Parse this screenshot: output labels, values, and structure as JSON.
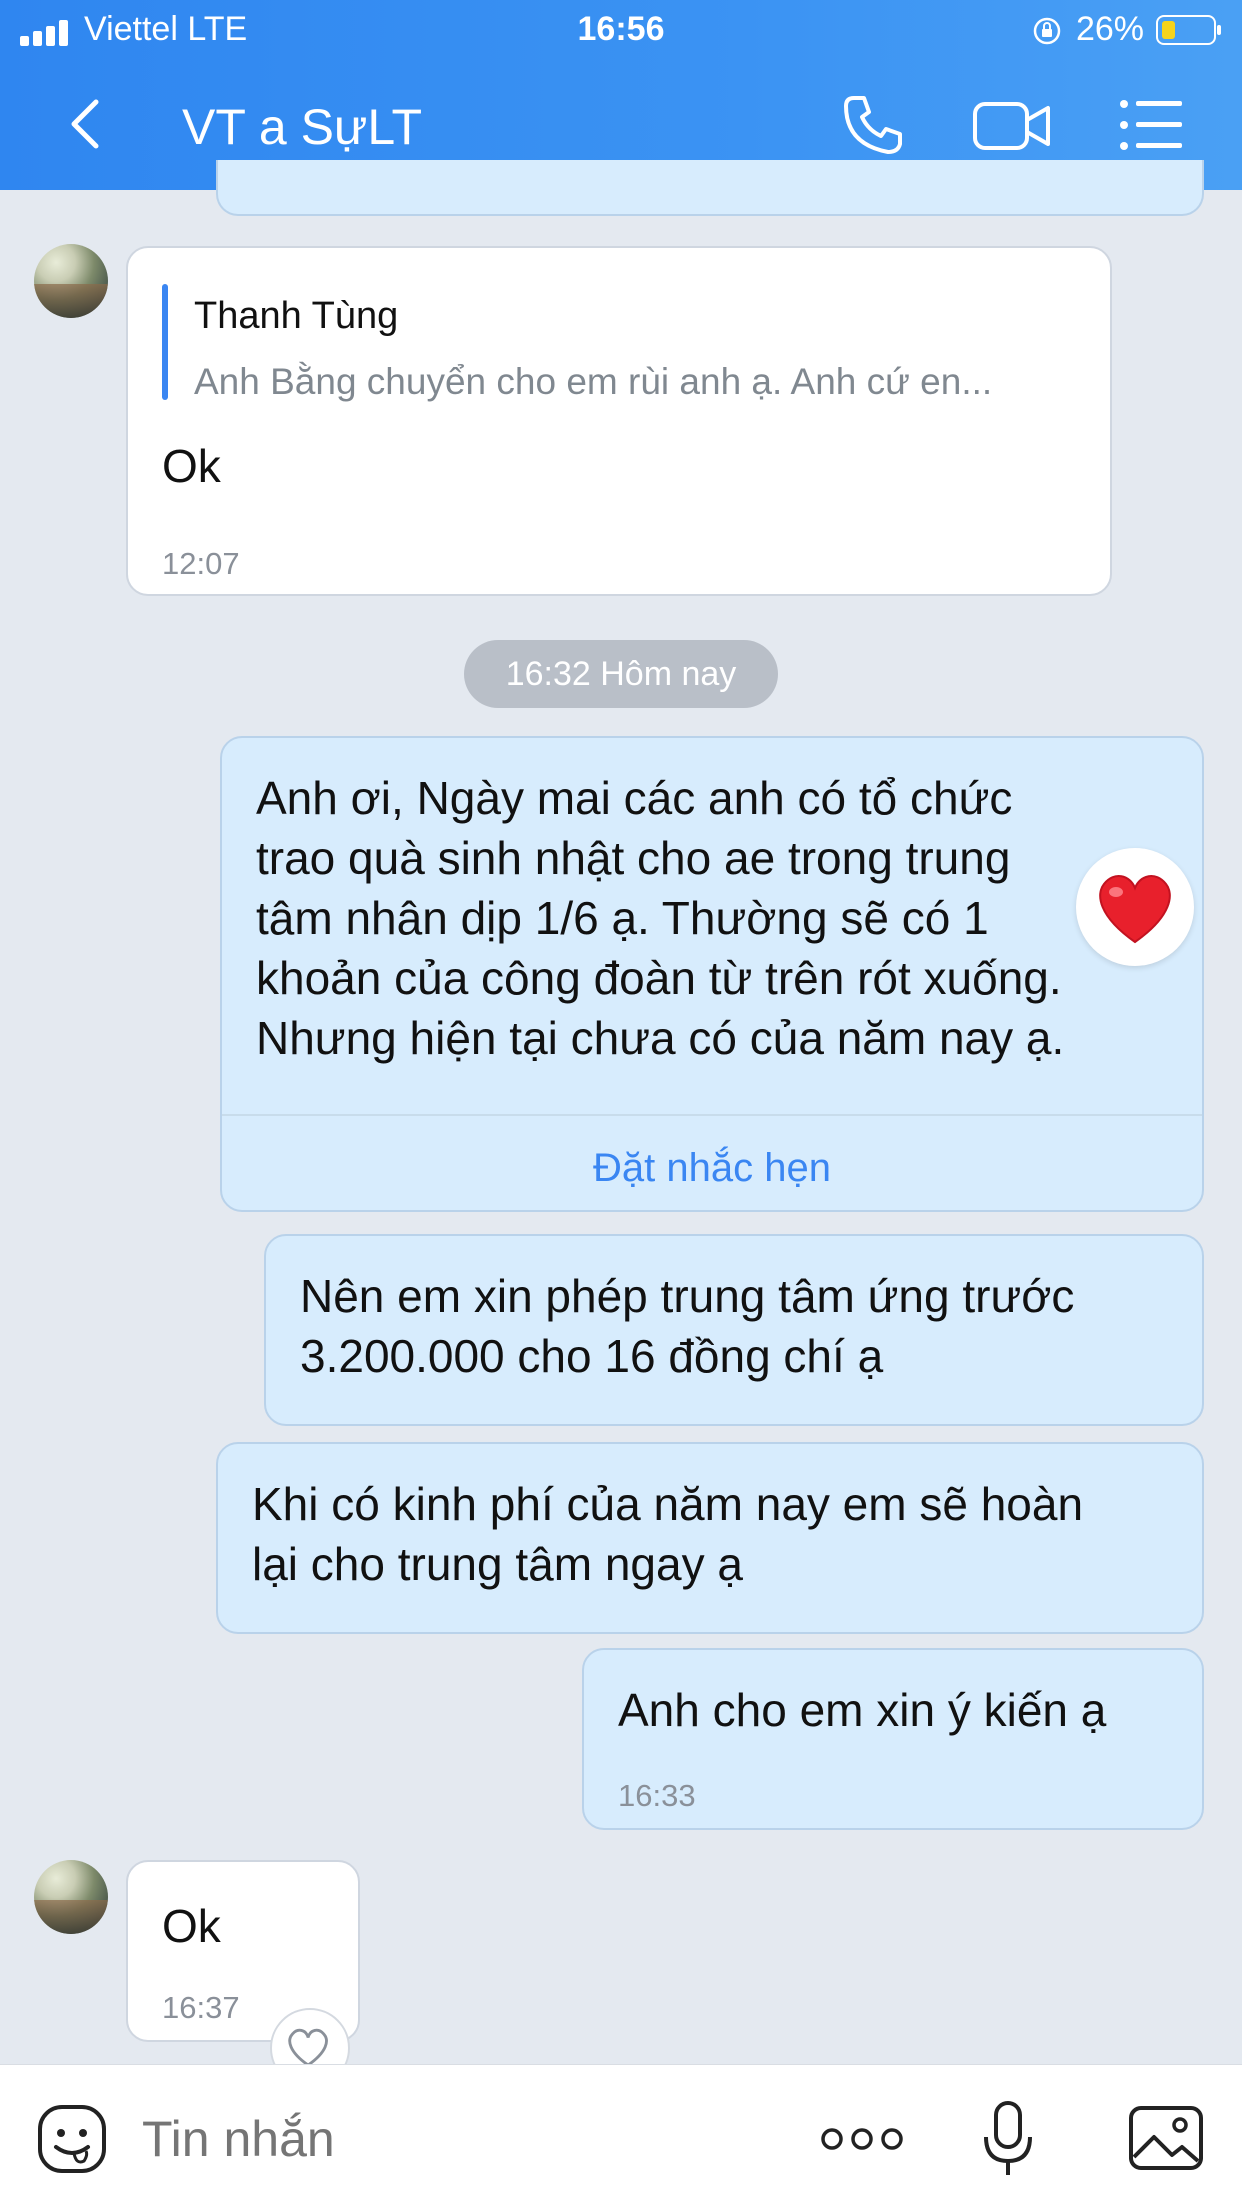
{
  "status_bar": {
    "carrier": "Viettel  LTE",
    "time": "16:56",
    "battery": "26%"
  },
  "header": {
    "title": "VT a SựLT"
  },
  "messages": [
    {
      "direction": "in",
      "quote_name": "Thanh Tùng",
      "quote_text": "Anh Bằng chuyển cho em rùi anh ạ. Anh cứ en...",
      "text": "Ok",
      "time": "12:07"
    },
    {
      "direction": "out",
      "text": "Anh ơi, Ngày mai các anh có tổ chức\ntrao quà sinh nhật cho ae trong trung\ntâm nhân dịp 1/6 ạ. Thường sẽ có 1\nkhoản của công đoàn từ trên rót xuống.\nNhưng hiện tại chưa có của năm nay ạ.",
      "action": "Đặt nhắc hẹn"
    },
    {
      "direction": "out",
      "text": "Nên em xin phép trung tâm ứng trước\n3.200.000 cho 16 đồng chí ạ"
    },
    {
      "direction": "out",
      "text": "Khi có kinh phí của năm nay em sẽ hoàn\nlại cho trung tâm ngay ạ"
    },
    {
      "direction": "out",
      "text": "Anh cho em xin ý kiến ạ",
      "time": "16:33"
    },
    {
      "direction": "in",
      "text": "Ok",
      "time": "16:37"
    }
  ],
  "time_divider": "16:32 Hôm nay",
  "composer": {
    "placeholder": "Tin nhắn"
  },
  "colors": {
    "header_blue": "#3b93f3",
    "bubble_out": "#d7ecfd",
    "link_blue": "#3a86f2"
  },
  "icons": [
    "signal-icon",
    "lock-rotation-icon",
    "battery-icon",
    "back-icon",
    "phone-icon",
    "video-call-icon",
    "menu-icon",
    "heart-reaction-icon",
    "heart-outline-icon",
    "emoji-icon",
    "more-icon",
    "microphone-icon",
    "image-icon"
  ]
}
